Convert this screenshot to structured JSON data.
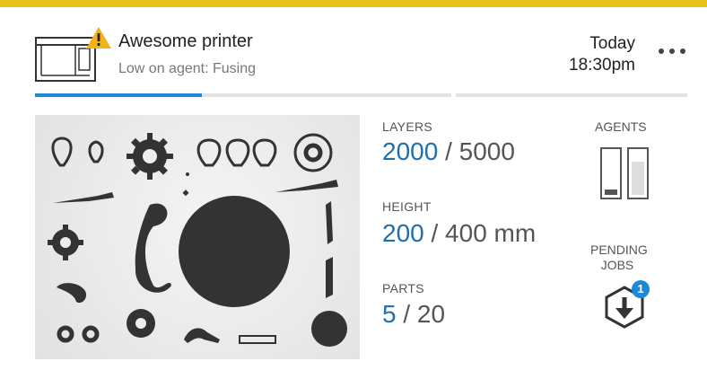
{
  "header": {
    "printer_name": "Awesome printer",
    "status_text": "Low on agent: Fusing",
    "date_label": "Today",
    "time_label": "18:30pm",
    "printer_icon": "printer-icon",
    "warning_icon": "warning-icon",
    "menu_icon": "more-options-icon"
  },
  "progress": {
    "job_progress": 0.4
  },
  "colors": {
    "accent": "#1e6fb0",
    "warning": "#e8c21a",
    "progress": "#1e8ad6"
  },
  "stats": {
    "layers": {
      "label": "LAYERS",
      "current": "2000",
      "total": " / 5000"
    },
    "height": {
      "label": "HEIGHT",
      "current": "200",
      "total": " / 400 mm"
    },
    "parts": {
      "label": "PARTS",
      "current": "5",
      "total": " / 20"
    }
  },
  "agents": {
    "label": "AGENTS",
    "levels": [
      0.12,
      0.78
    ]
  },
  "pending_jobs": {
    "label_line1": "PENDING",
    "label_line2": "JOBS",
    "count": "1",
    "icon": "download-jobs-icon"
  }
}
